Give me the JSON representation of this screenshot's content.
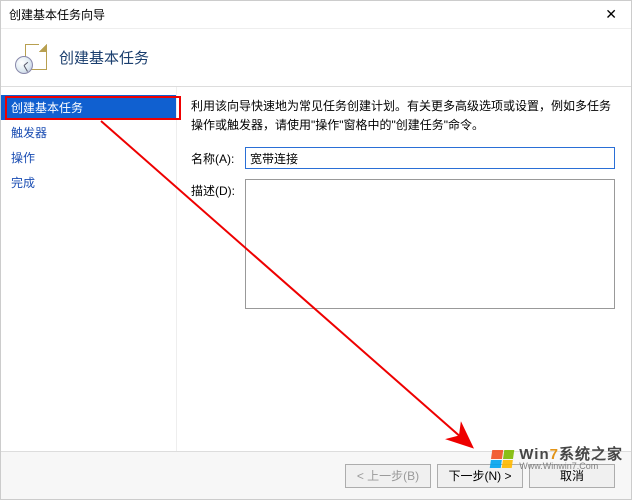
{
  "window": {
    "title": "创建基本任务向导",
    "close_glyph": "✕"
  },
  "header": {
    "heading": "创建基本任务"
  },
  "sidebar": {
    "steps": [
      {
        "label": "创建基本任务",
        "active": true
      },
      {
        "label": "触发器",
        "active": false
      },
      {
        "label": "操作",
        "active": false
      },
      {
        "label": "完成",
        "active": false
      }
    ]
  },
  "content": {
    "hint": "利用该向导快速地为常见任务创建计划。有关更多高级选项或设置，例如多任务操作或触发器，请使用\"操作\"窗格中的\"创建任务\"命令。",
    "name_label": "名称(A):",
    "name_value": "宽带连接",
    "desc_label": "描述(D):",
    "desc_value": ""
  },
  "footer": {
    "back": "< 上一步(B)",
    "next": "下一步(N) >",
    "cancel": "取消"
  },
  "watermark": {
    "brand_prefix": "Win",
    "brand_suffix": "7",
    "brand_tail": "系统之家",
    "url": "Www.Winwin7.Com"
  }
}
